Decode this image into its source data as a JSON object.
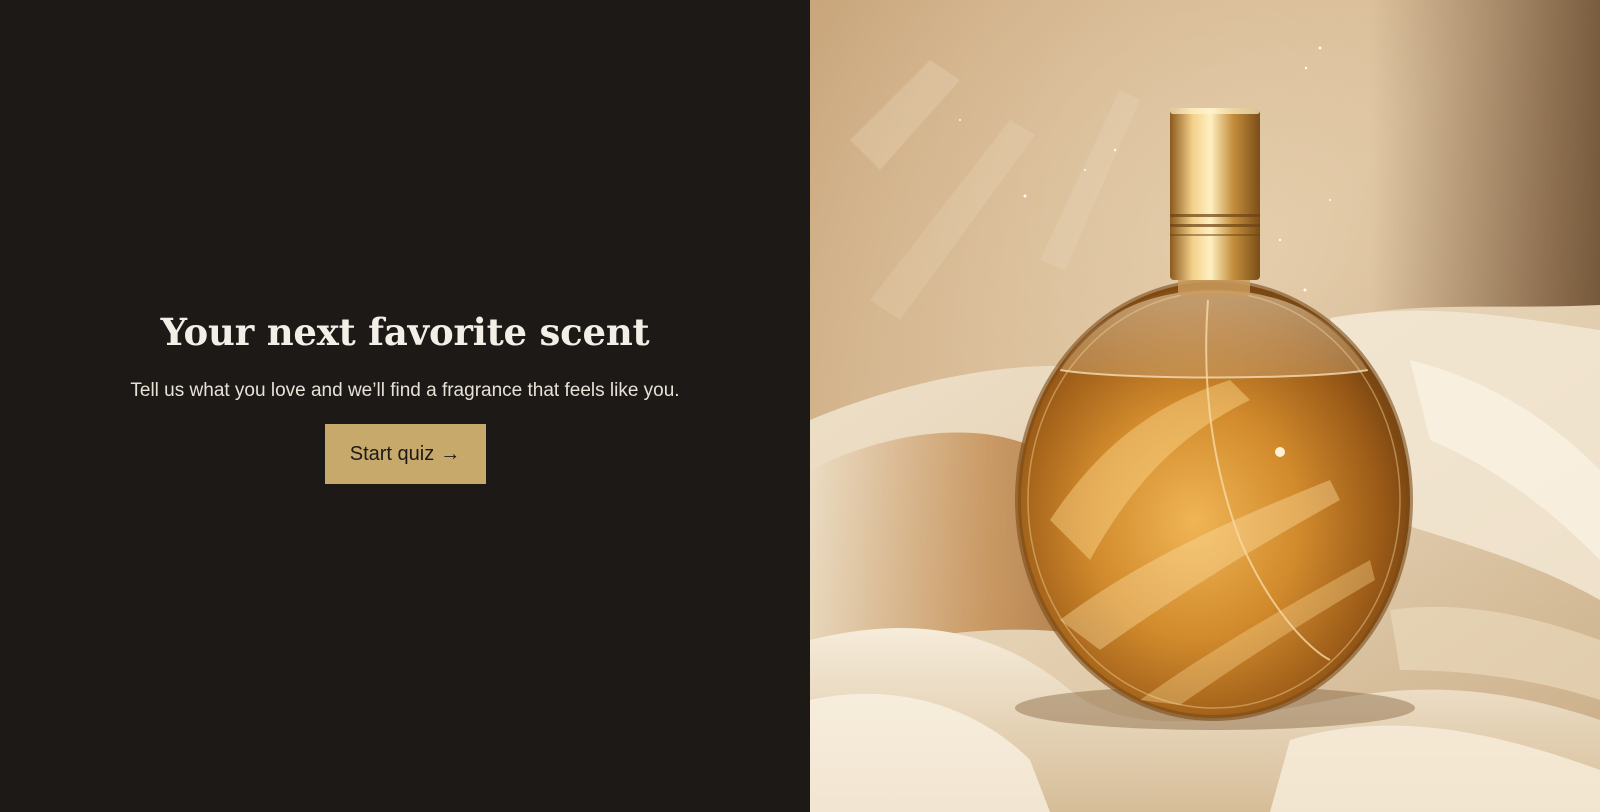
{
  "hero": {
    "title": "Your next favorite scent",
    "subtitle": "Tell us what you love and we’ll find a fragrance that feels like you.",
    "cta_label": "Start quiz",
    "cta_arrow": "→"
  },
  "colors": {
    "panel_background": "#1c1917",
    "title_text": "#f3eee6",
    "button_background": "#c7a96c",
    "button_text": "#1c1917"
  },
  "image": {
    "subject": "perfume-bottle-on-satin"
  }
}
